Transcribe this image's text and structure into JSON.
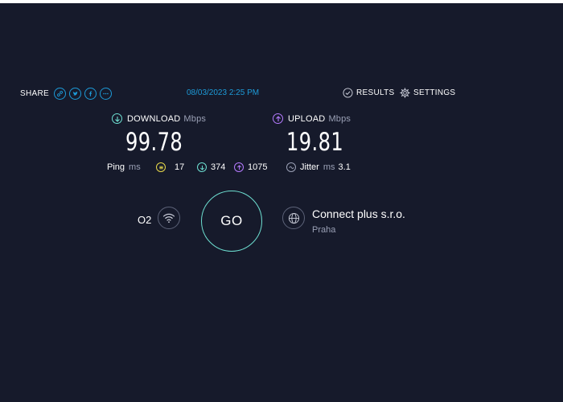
{
  "header": {
    "share_label": "SHARE",
    "share_buttons": [
      "link-icon",
      "twitter-icon",
      "facebook-icon",
      "more-icon"
    ],
    "timestamp": "08/03/2023 2:25 PM",
    "results_label": "RESULTS",
    "settings_label": "SETTINGS"
  },
  "download": {
    "label": "DOWNLOAD",
    "unit": "Mbps",
    "value": "99.78"
  },
  "upload": {
    "label": "UPLOAD",
    "unit": "Mbps",
    "value": "19.81"
  },
  "stats": {
    "ping_label": "Ping",
    "ping_unit": "ms",
    "ping_value": "17",
    "download_latency": "374",
    "upload_latency": "1075",
    "jitter_label": "Jitter",
    "jitter_unit": "ms",
    "jitter_value": "3.1"
  },
  "connection": {
    "isp": "O2",
    "go_label": "GO",
    "server_name": "Connect plus s.r.o.",
    "server_city": "Praha"
  },
  "colors": {
    "background": "#161a2b",
    "accent_blue": "#1d9bd8",
    "download_teal": "#6ee0d2",
    "upload_purple": "#b57bff",
    "ping_yellow": "#e8d94a"
  }
}
